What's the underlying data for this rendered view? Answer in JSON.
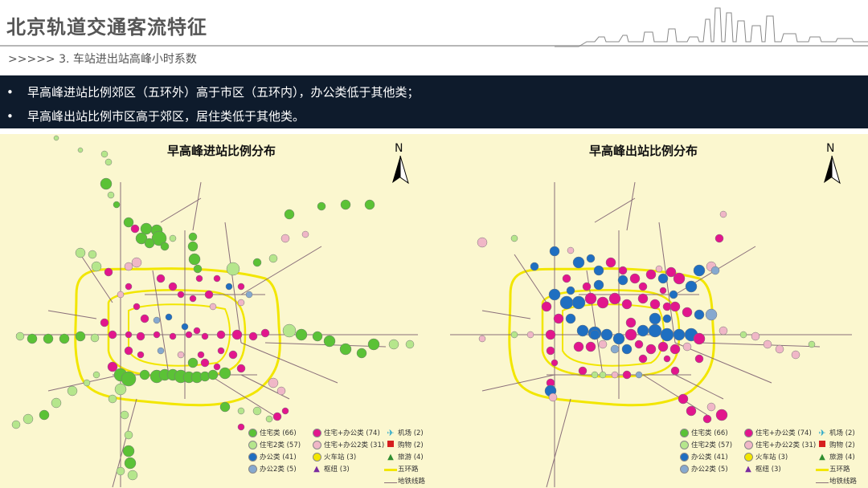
{
  "header": {
    "title": "北京轨道交通客流特征",
    "subtitle": ">>>>> 3. 车站进出站高峰小时系数"
  },
  "bullets": [
    "早高峰进站比例郊区（五环外）高于市区（五环内），办公类低于其他类；",
    "早高峰出站比例市区高于郊区，居住类低于其他类。"
  ],
  "maps": [
    {
      "title": "早高峰进站比例分布",
      "north": "N"
    },
    {
      "title": "早高峰出站比例分布",
      "north": "N"
    }
  ],
  "legend": {
    "items": [
      {
        "label": "住宅类 (66)",
        "symbol": "circle",
        "color": "#5bc236"
      },
      {
        "label": "住宅2类 (57)",
        "symbol": "circle",
        "color": "#b5e68c"
      },
      {
        "label": "办公类 (41)",
        "symbol": "circle",
        "color": "#1f6fc1"
      },
      {
        "label": "办公2类 (5)",
        "symbol": "circle",
        "color": "#86a9cf"
      },
      {
        "label": "住宅+办公类 (74)",
        "symbol": "circle",
        "color": "#e2168d"
      },
      {
        "label": "住宅+办公2类 (31)",
        "symbol": "circle",
        "color": "#f0b7c7"
      },
      {
        "label": "火车站 (3)",
        "symbol": "circle",
        "color": "#f2e600"
      },
      {
        "label": "枢纽 (3)",
        "symbol": "triangle",
        "color": "#7a2ba0"
      },
      {
        "label": "机场 (2)",
        "symbol": "plane",
        "color": "#27a7c9"
      },
      {
        "label": "购物 (2)",
        "symbol": "square",
        "color": "#d61f1f"
      },
      {
        "label": "旅游 (4)",
        "symbol": "triangle",
        "color": "#2f8d2f"
      },
      {
        "label": "五环路",
        "symbol": "line",
        "color": "#f2e600"
      },
      {
        "label": "地铁线路",
        "symbol": "line",
        "color": "#8a6f7a"
      }
    ]
  },
  "colors": {
    "banner": "#0e1b2c",
    "map_bg": "#fbf7cf",
    "ring": "#f2e600"
  }
}
